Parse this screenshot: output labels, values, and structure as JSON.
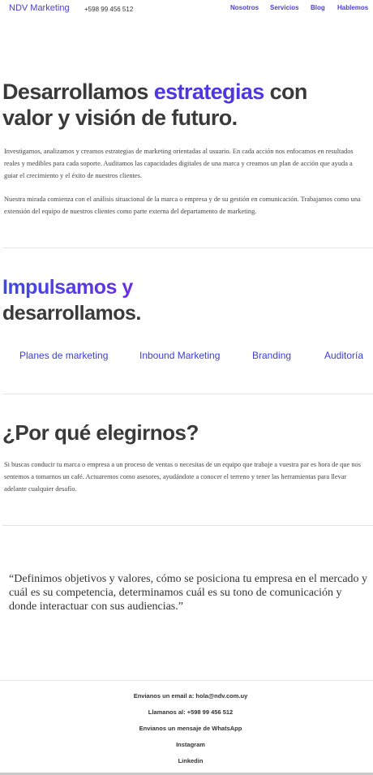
{
  "header": {
    "brand": "NDV Marketing",
    "phone": "+598 99 456 512",
    "nav": [
      "Nosotros",
      "Servicios",
      "Blog",
      "Hablemos"
    ]
  },
  "hero": {
    "title_before": "Desarrollamos ",
    "title_accent": "estrategias",
    "title_after": " con valor y visión de futuro.",
    "paragraph1": "Investigamos, analizamos y creamos estrategias de marketing orientadas al usuario. En cada acción nos enfocamos en resultados reales y medibles para cada soporte. Auditamos las capacidades digitales de una marca y creamos un plan de acción que ayuda a guiar el crecimiento y el éxito de nuestros clientes.",
    "paragraph2": "Nuestra mirada comienza con el análisis situacional de la marca o empresa y de su gestión en comunicación. Trabajamos como una extensión del equipo de nuestros clientes como parte externa del departamento de marketing."
  },
  "services": {
    "title_accent": "Impulsamos y",
    "title_rest": "desarrollamos.",
    "items": [
      "Planes de marketing",
      "Inbound Marketing",
      "Branding",
      "Auditoría"
    ]
  },
  "why": {
    "title": "¿Por qué elegirnos?",
    "paragraph": "Si buscas conducir tu marca o empresa a un proceso de ventas o necesitas de un equipo que trabaje a vuestra par es hora de que nos sentemos a tomarnos un café. Actuaremos como asesores, ayudándote a conocer el terreno y tener las herramientas para llevar adelante cualquier desafío."
  },
  "quote": "“Definimos objetivos y valores, cómo se posiciona tu empresa en el mercado y cuál es su competencia, determinamos cuál es su tono de comunicación y donde interactuar con sus audiencias.”",
  "footer": {
    "email": "Envianos un email a: hola@ndv.com.uy",
    "call": "Llamanos al: +598 99 456 512",
    "whatsapp": "Envianos un mensaje de WhatsApp",
    "instagram": "Instagram",
    "linkedin": "Linkedin"
  },
  "colors": {
    "accent": "#4f37e0",
    "link": "#4a3fd6",
    "text": "#3a3a3a"
  }
}
